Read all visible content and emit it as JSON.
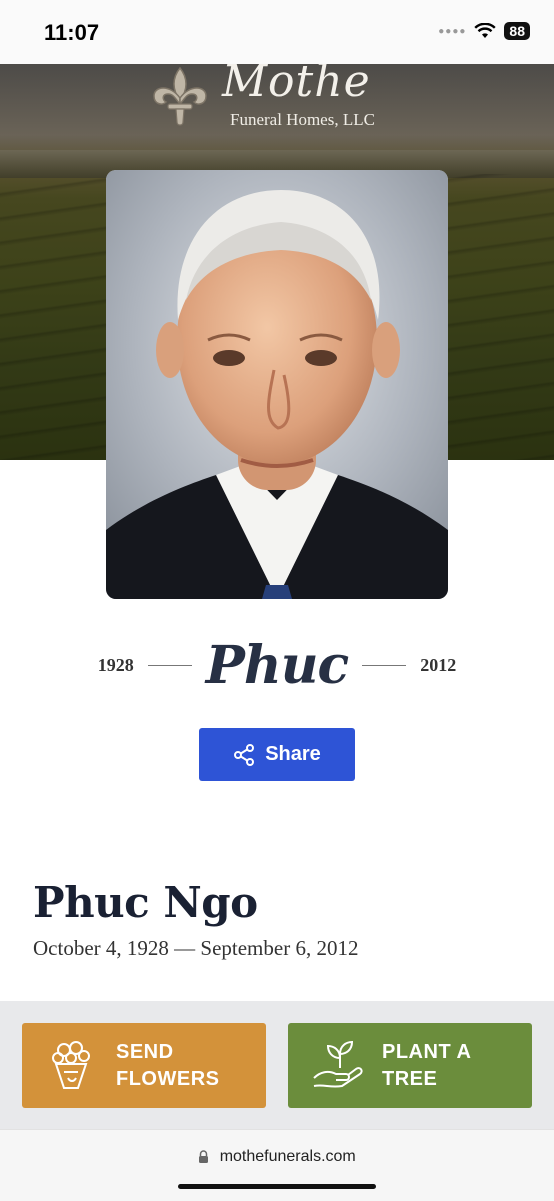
{
  "status_bar": {
    "time": "11:07",
    "battery": "88"
  },
  "header": {
    "brand_name": "Mothe",
    "brand_sub": "Funeral Homes, LLC"
  },
  "obituary": {
    "birth_year": "1928",
    "death_year": "2012",
    "first_name": "Phuc",
    "full_name": "Phuc Ngo",
    "dates": "October 4, 1928 — September 6, 2012"
  },
  "share": {
    "label": "Share"
  },
  "actions": {
    "send_flowers_line1": "SEND",
    "send_flowers_line2": "FLOWERS",
    "plant_tree_line1": "PLANT A",
    "plant_tree_line2": "TREE"
  },
  "browser": {
    "url": "mothefunerals.com"
  },
  "colors": {
    "share_button": "#2e54d6",
    "flowers_button": "#d3923a",
    "tree_button": "#6b8d3c",
    "heading": "#1a2133"
  }
}
